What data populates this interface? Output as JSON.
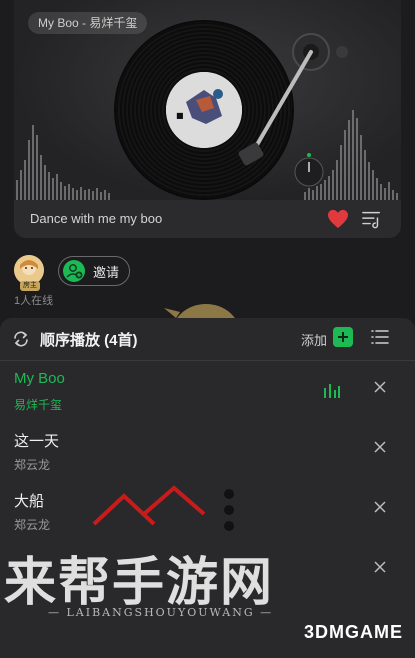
{
  "player": {
    "song_pill": "My Boo - 易烊千玺",
    "caption": "Dance with me my boo",
    "liked": true,
    "accent_color": "#1db954",
    "heart_color": "#e0393e"
  },
  "room": {
    "host_badge": "房主",
    "invite_label": "邀请",
    "online_text": "1人在线"
  },
  "playlist": {
    "mode_label": "顺序播放 (4首)",
    "add_label": "添加",
    "songs": [
      {
        "title": "My Boo",
        "artist": "易烊千玺",
        "playing": true
      },
      {
        "title": "这一天",
        "artist": "郑云龙",
        "playing": false
      },
      {
        "title": "大船",
        "artist": "郑云龙",
        "playing": false
      },
      {
        "title": "",
        "artist": "",
        "playing": false
      }
    ]
  },
  "watermark": {
    "main": "来帮手游网",
    "sub": "— LAIBANGSHOUYOUWANG —",
    "brand": "3DMGAME"
  },
  "icons": [
    "heart-icon",
    "playlist-icon",
    "invite-icon",
    "repeat-icon",
    "add-icon",
    "list-icon",
    "equalizer-icon",
    "close-icon"
  ]
}
